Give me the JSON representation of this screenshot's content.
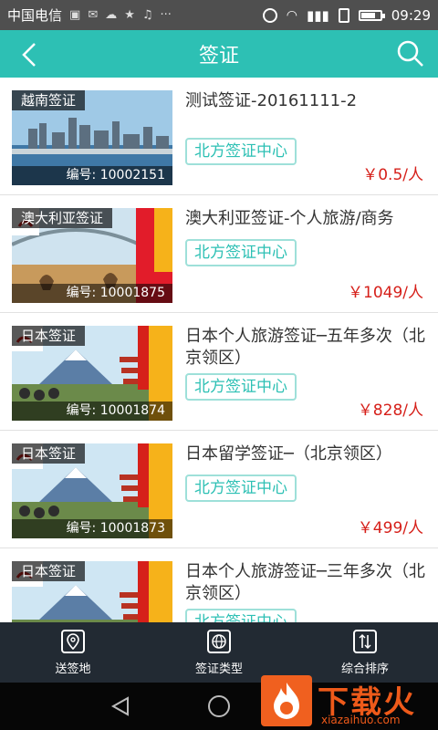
{
  "status": {
    "carrier": "中国电信",
    "time": "09:29"
  },
  "header": {
    "title": "签证"
  },
  "list": [
    {
      "tag": "越南签证",
      "code": "编号: 10002151",
      "name": "测试签证-20161111-2",
      "center": "北方签证中心",
      "price": "￥0.5/人",
      "kind": "city"
    },
    {
      "tag": "澳大利亚签证",
      "code": "编号: 10001875",
      "name": "澳大利亚签证-个人旅游/商务",
      "center": "北方签证中心",
      "price": "￥1049/人",
      "kind": "australia",
      "banner": "澳大利亚"
    },
    {
      "tag": "日本签证",
      "code": "编号: 10001874",
      "name": "日本个人旅游签证─五年多次（北京领区）",
      "center": "北方签证中心",
      "price": "￥828/人",
      "kind": "japan",
      "banner": "日本签证"
    },
    {
      "tag": "日本签证",
      "code": "编号: 10001873",
      "name": "日本留学签证─（北京领区）",
      "center": "北方签证中心",
      "price": "￥499/人",
      "kind": "japan",
      "banner": "日本签证"
    },
    {
      "tag": "日本签证",
      "code": "",
      "name": "日本个人旅游签证─三年多次（北京领区）",
      "center": "北方签证中心",
      "price": "",
      "kind": "japan",
      "banner": "日本签证"
    }
  ],
  "tabs": [
    {
      "label": "送签地",
      "icon": "location-pin-icon"
    },
    {
      "label": "签证类型",
      "icon": "globe-icon"
    },
    {
      "label": "综合排序",
      "icon": "sort-icon"
    }
  ],
  "watermark": {
    "big": "下载火",
    "small": "xiazaihuo.com"
  },
  "colors": {
    "accent": "#2dc0b4",
    "price": "#d6201a",
    "tabbar": "#222a33"
  }
}
